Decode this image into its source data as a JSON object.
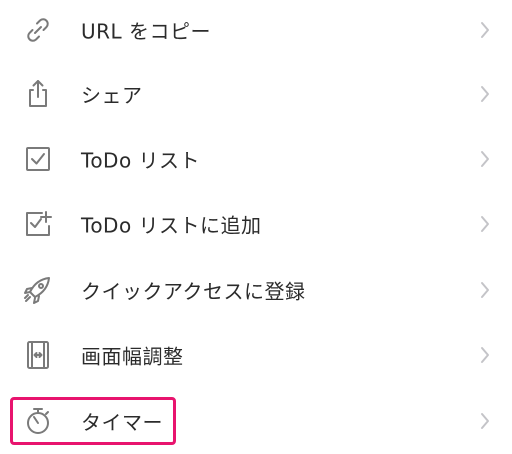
{
  "menu": {
    "items": [
      {
        "label": "URL をコピー",
        "icon": "link-icon"
      },
      {
        "label": "シェア",
        "icon": "share-icon"
      },
      {
        "label": "ToDo リスト",
        "icon": "checkbox-icon"
      },
      {
        "label": "ToDo リストに追加",
        "icon": "checkbox-add-icon"
      },
      {
        "label": "クイックアクセスに登録",
        "icon": "rocket-icon"
      },
      {
        "label": "画面幅調整",
        "icon": "width-adjust-icon"
      },
      {
        "label": "タイマー",
        "icon": "stopwatch-icon"
      }
    ]
  },
  "colors": {
    "icon": "#7a7a7a",
    "chevron": "#c4c4c8",
    "text": "#2b2b2b",
    "highlight": "#e8146e"
  }
}
